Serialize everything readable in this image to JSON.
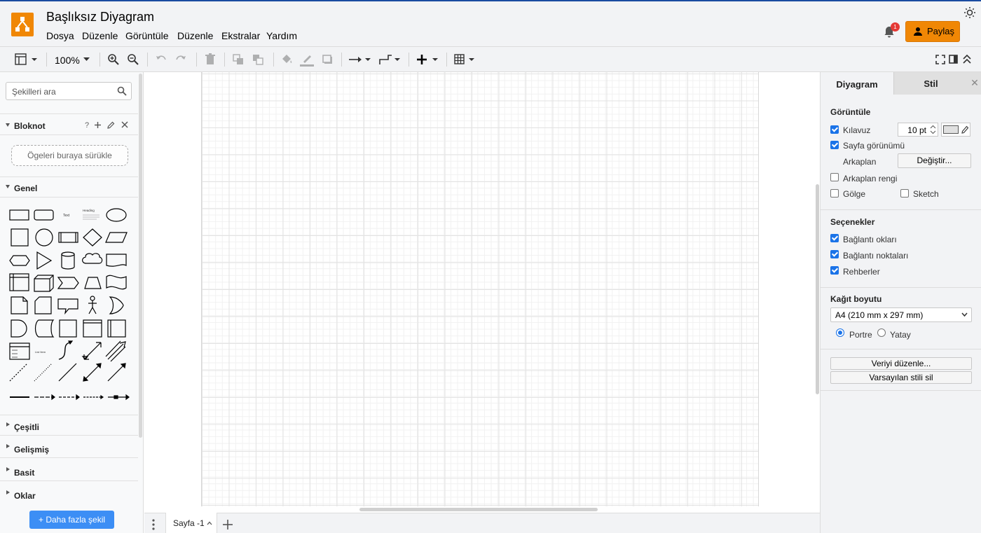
{
  "app": {
    "title": "Başlıksız Diyagram",
    "brand_color": "#f08705",
    "accent_color": "#194ba0"
  },
  "menu": [
    "Dosya",
    "Düzenle",
    "Görüntüle",
    "Düzenle",
    "Ekstralar",
    "Yardım"
  ],
  "header": {
    "notification_count": "1",
    "share_label": "Paylaş",
    "theme_icon": "sun-icon"
  },
  "toolbar": {
    "zoom": "100%",
    "icons": [
      "format-panel-icon",
      "zoom-in-icon",
      "zoom-out-icon",
      "undo-icon",
      "redo-icon",
      "delete-icon",
      "to-front-icon",
      "to-back-icon",
      "fill-color-icon",
      "line-color-icon",
      "shadow-icon",
      "connection-icon",
      "waypoints-icon",
      "insert-icon",
      "table-icon",
      "fullscreen-icon",
      "toggle-panel-icon",
      "collapse-icon"
    ]
  },
  "sidebar": {
    "search_placeholder": "Şekilleri ara",
    "scratchpad": {
      "label": "Bloknot",
      "help": "?",
      "drop_hint": "Ögeleri buraya sürükle"
    },
    "general": {
      "label": "Genel"
    },
    "sections": [
      "Çeşitli",
      "Gelişmiş",
      "Basit",
      "Oklar"
    ],
    "more_shapes": "Daha fazla şekil"
  },
  "canvas": {
    "page_tab": "Sayfa -1"
  },
  "panel": {
    "tabs": [
      "Diyagram",
      "Stil"
    ],
    "view": {
      "title": "Görüntüle",
      "grid": {
        "label": "Kılavuz",
        "checked": true,
        "size": "10 pt"
      },
      "page_view": {
        "label": "Sayfa görünümü",
        "checked": true
      },
      "background": {
        "label": "Arkaplan",
        "button": "Değiştir..."
      },
      "background_color": {
        "label": "Arkaplan rengi",
        "checked": false
      },
      "shadow": {
        "label": "Gölge",
        "checked": false
      },
      "sketch": {
        "label": "Sketch",
        "checked": false
      }
    },
    "options": {
      "title": "Seçenekler",
      "connection_arrows": "Bağlantı okları",
      "connection_points": "Bağlantı noktaları",
      "guides": "Rehberler"
    },
    "paper": {
      "title": "Kağıt boyutu",
      "selected": "A4 (210 mm x 297 mm)",
      "portrait": "Portre",
      "landscape": "Yatay"
    },
    "buttons": {
      "edit_data": "Veriyi düzenle...",
      "clear_default_style": "Varsayılan stili sil"
    }
  }
}
